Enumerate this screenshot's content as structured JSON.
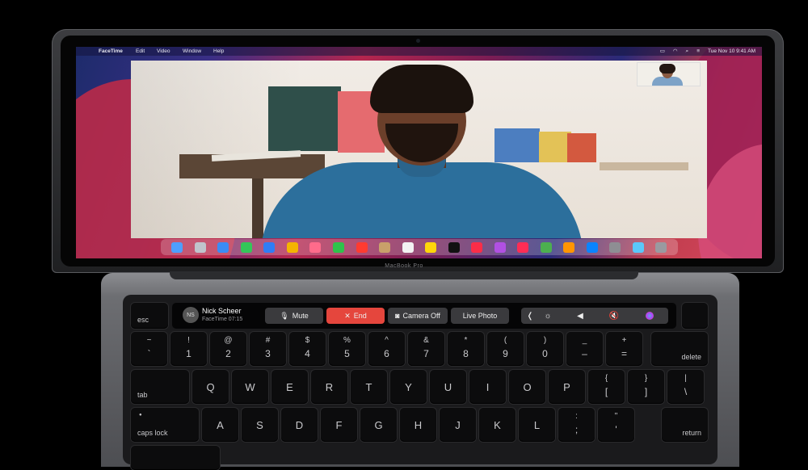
{
  "menubar": {
    "apple": "",
    "items": [
      "FaceTime",
      "Edit",
      "Video",
      "Window",
      "Help"
    ],
    "datetime": "Tue Nov 10   9:41 AM"
  },
  "laptop": {
    "brand": "MacBook Pro"
  },
  "touchbar": {
    "esc": "esc",
    "avatar_initials": "NS",
    "caller_name": "Nick Scheer",
    "call_info": "FaceTime 07:15",
    "mute": "Mute",
    "end": "End",
    "camera_off": "Camera Off",
    "live_photo": "Live Photo",
    "collapse": "❬",
    "brightness": "☼",
    "volume": "◀",
    "mute_volume": "🔇"
  },
  "keyboard": {
    "row1": [
      {
        "top": "~",
        "bot": "`"
      },
      {
        "top": "!",
        "bot": "1"
      },
      {
        "top": "@",
        "bot": "2"
      },
      {
        "top": "#",
        "bot": "3"
      },
      {
        "top": "$",
        "bot": "4"
      },
      {
        "top": "%",
        "bot": "5"
      },
      {
        "top": "^",
        "bot": "6"
      },
      {
        "top": "&",
        "bot": "7"
      },
      {
        "top": "*",
        "bot": "8"
      },
      {
        "top": "(",
        "bot": "9"
      },
      {
        "top": ")",
        "bot": "0"
      },
      {
        "top": "_",
        "bot": "–"
      },
      {
        "top": "+",
        "bot": "="
      }
    ],
    "delete": "delete",
    "tab": "tab",
    "row2": [
      "Q",
      "W",
      "E",
      "R",
      "T",
      "Y",
      "U",
      "I",
      "O",
      "P"
    ],
    "row2_brackets": [
      {
        "top": "{",
        "bot": "["
      },
      {
        "top": "}",
        "bot": "]"
      },
      {
        "top": "|",
        "bot": "\\"
      }
    ],
    "caps": "caps lock",
    "row3": [
      "A",
      "S",
      "D",
      "F",
      "G",
      "H",
      "J",
      "K",
      "L"
    ],
    "row3_punct": [
      {
        "top": ":",
        "bot": ";"
      },
      {
        "top": "\"",
        "bot": "'"
      }
    ],
    "return": "return"
  }
}
